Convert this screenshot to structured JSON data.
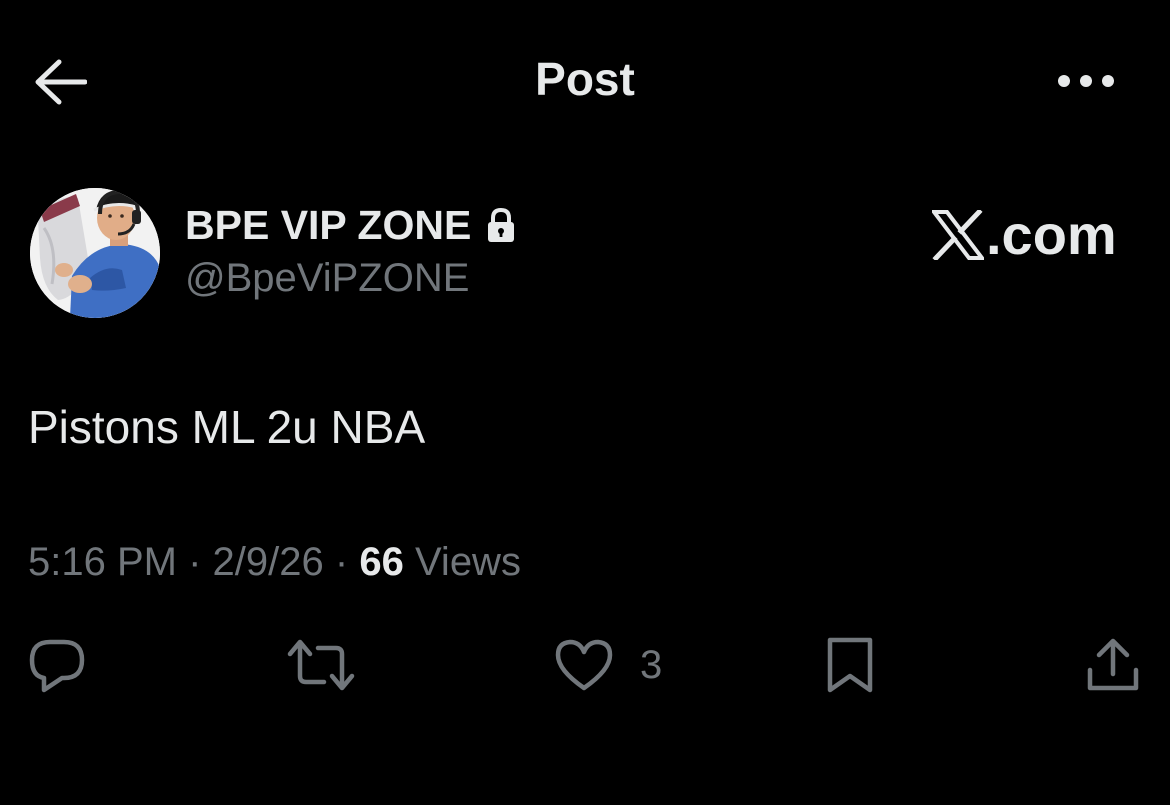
{
  "header": {
    "title": "Post",
    "back_icon": "arrow-left-icon",
    "more_icon": "more-horizontal-icon"
  },
  "author": {
    "display_name": "BPE VIP ZONE",
    "handle": "@BpeViPZONE",
    "protected_icon": "lock-icon",
    "avatar_icon": "avatar-image"
  },
  "watermark": {
    "text": ".com",
    "logo_icon": "x-logo-icon"
  },
  "post": {
    "text": "Pistons ML 2u NBA",
    "time": "5:16 PM",
    "date": "2/9/26",
    "separator": "·",
    "views_count": "66",
    "views_label": "Views"
  },
  "actions": {
    "reply_icon": "reply-icon",
    "repost_icon": "repost-icon",
    "like_icon": "heart-icon",
    "like_count": "3",
    "bookmark_icon": "bookmark-icon",
    "share_icon": "share-icon"
  },
  "colors": {
    "background": "#000000",
    "primary_text": "#e7e9ea",
    "secondary_text": "#71767b"
  }
}
